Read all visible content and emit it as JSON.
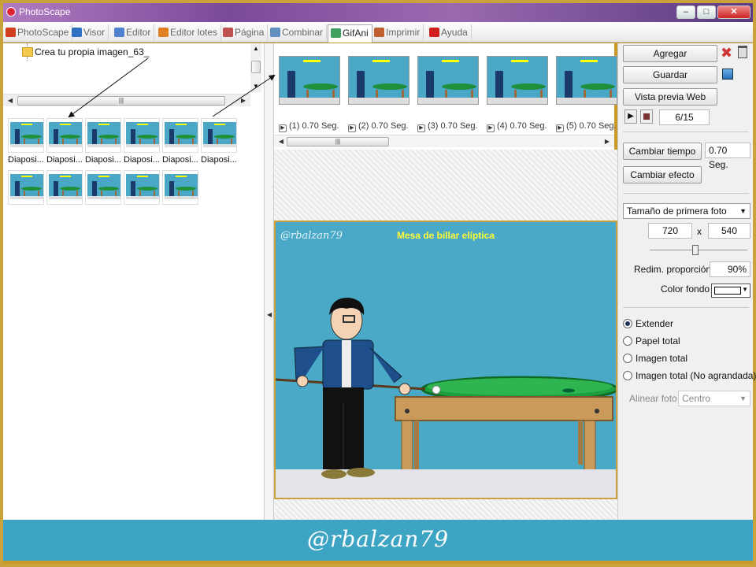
{
  "window": {
    "title": "PhotoScape"
  },
  "tabs": [
    {
      "label": "PhotoScape",
      "color": "#d04020"
    },
    {
      "label": "Visor",
      "color": "#3070c0"
    },
    {
      "label": "Editor",
      "color": "#5080d0"
    },
    {
      "label": "Editor lotes",
      "color": "#e08020"
    },
    {
      "label": "Página",
      "color": "#c05050"
    },
    {
      "label": "Combinar",
      "color": "#6090c0"
    },
    {
      "label": "GifAni",
      "color": "#40a060"
    },
    {
      "label": "Imprimir",
      "color": "#c06030"
    },
    {
      "label": "Ayuda",
      "color": "#d02020"
    }
  ],
  "active_tab": "GifAni",
  "left_panel": {
    "folder_name": "Crea tu propia imagen_63_",
    "thumbnails_row1_labels": [
      "Diaposi...",
      "Diaposi...",
      "Diaposi...",
      "Diaposi...",
      "Diaposi...",
      "Diaposi..."
    ]
  },
  "frames": [
    {
      "label": "(1) 0.70 Seg."
    },
    {
      "label": "(2) 0.70 Seg."
    },
    {
      "label": "(3) 0.70 Seg."
    },
    {
      "label": "(4) 0.70 Seg."
    },
    {
      "label": "(5) 0.70 Seg."
    }
  ],
  "preview": {
    "handle": "@rbalzan79",
    "title": "Mesa de billar elíptica"
  },
  "right_panel": {
    "agregar": "Agregar",
    "guardar": "Guardar",
    "vista_previa": "Vista previa Web",
    "frame_counter": "6/15",
    "cambiar_tiempo": "Cambiar tiempo",
    "tiempo_value": "0.70 Seg.",
    "cambiar_efecto": "Cambiar efecto",
    "size_select": "Tamaño de primera foto",
    "width": "720",
    "x_sep": "x",
    "height": "540",
    "redim_label": "Redim. proporción",
    "redim_value": "90%",
    "color_fondo": "Color fondo",
    "radio_options": [
      "Extender",
      "Papel total",
      "Imagen total",
      "Imagen total (No agrandada)"
    ],
    "radio_selected": "Extender",
    "alinear_label": "Alinear foto",
    "alinear_value": "Centro"
  },
  "footer": {
    "handle": "@rbalzan79"
  }
}
